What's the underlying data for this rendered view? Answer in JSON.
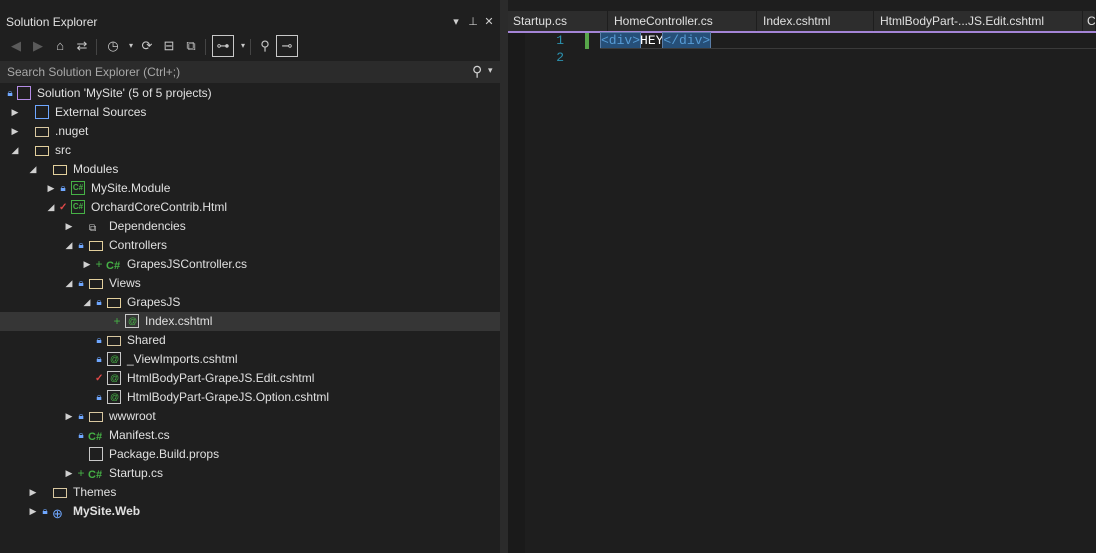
{
  "solution_explorer": {
    "title": "Solution Explorer",
    "title_buttons": [
      "▾",
      "⊥",
      "✕"
    ],
    "search_placeholder": "Search Solution Explorer (Ctrl+;)",
    "toolbar": [
      "back-icon",
      "forward-icon",
      "home-icon",
      "switch-views-icon",
      "pending-changes-filter-icon",
      "sync-icon",
      "collapse-all-icon",
      "show-all-files-icon",
      "preview-selected-icon",
      "properties-icon",
      "git-icon"
    ],
    "tree": [
      {
        "label": "Solution 'MySite' (5 of 5 projects)",
        "icon": "solution-icon",
        "lock": true
      },
      {
        "label": "External Sources",
        "icon": "external-sources-icon",
        "expander": "▶"
      },
      {
        "label": ".nuget",
        "icon": "folder-icon",
        "expander": "▶"
      },
      {
        "label": "src",
        "icon": "folder-open-icon",
        "expander": "◢"
      },
      {
        "label": "Modules",
        "icon": "folder-open-icon",
        "expander": "◢"
      },
      {
        "label": "MySite.Module",
        "icon": "csproj-icon",
        "expander": "▶",
        "lock": true
      },
      {
        "label": "OrchardCoreContrib.Html",
        "icon": "csproj-icon",
        "expander": "◢",
        "check": true
      },
      {
        "label": "Dependencies",
        "icon": "dependencies-icon",
        "expander": "▶"
      },
      {
        "label": "Controllers",
        "icon": "folder-open-icon",
        "expander": "◢",
        "lock": true
      },
      {
        "label": "GrapesJSController.cs",
        "icon": "csharp-file-icon",
        "expander": "▶",
        "plus": true
      },
      {
        "label": "Views",
        "icon": "folder-open-icon",
        "expander": "◢",
        "lock": true
      },
      {
        "label": "GrapesJS",
        "icon": "folder-open-icon",
        "expander": "◢",
        "lock": true
      },
      {
        "label": "Index.cshtml",
        "icon": "razor-file-icon",
        "plus": true,
        "selected": true
      },
      {
        "label": "Shared",
        "icon": "folder-icon",
        "lock": true
      },
      {
        "label": "_ViewImports.cshtml",
        "icon": "razor-file-icon",
        "lock": true
      },
      {
        "label": "HtmlBodyPart-GrapeJS.Edit.cshtml",
        "icon": "razor-file-icon",
        "check": true
      },
      {
        "label": "HtmlBodyPart-GrapeJS.Option.cshtml",
        "icon": "razor-file-icon",
        "lock": true
      },
      {
        "label": "wwwroot",
        "icon": "folder-icon",
        "expander": "▶",
        "lock": true
      },
      {
        "label": "Manifest.cs",
        "icon": "csharp-file-icon",
        "lock": true
      },
      {
        "label": "Package.Build.props",
        "icon": "props-file-icon"
      },
      {
        "label": "Startup.cs",
        "icon": "csharp-file-icon",
        "expander": "▶",
        "plus": true
      },
      {
        "label": "Themes",
        "icon": "folder-icon",
        "expander": "▶"
      },
      {
        "label": "MySite.Web",
        "icon": "web-project-icon",
        "expander": "▶",
        "lock": true,
        "bold": true
      }
    ]
  },
  "editor": {
    "tabs": [
      "Startup.cs",
      "HomeController.cs",
      "Index.cshtml",
      "HtmlBodyPart-...JS.Edit.cshtml",
      "C"
    ],
    "line_numbers": [
      "1",
      "2"
    ],
    "code": {
      "open_tag": "<div>",
      "content": "HEY",
      "close_tag": "</div>"
    }
  },
  "colors": {
    "accent": "#a484d6",
    "selection": "#264f78",
    "csharp": "#46b146",
    "lock": "#6fa7ff"
  }
}
